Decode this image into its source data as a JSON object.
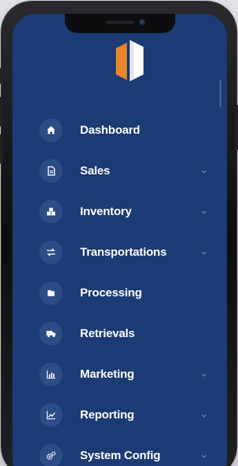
{
  "app": {
    "logo_icon": "hexagon-logo-icon",
    "brand_colors": {
      "orange": "#e8842c",
      "white": "#ffffff",
      "navy": "#1c3a73",
      "icon_bg": "#2d4c85"
    }
  },
  "menu": {
    "items": [
      {
        "label": "Dashboard",
        "icon": "home-icon",
        "has_submenu": false
      },
      {
        "label": "Sales",
        "icon": "document-icon",
        "has_submenu": true
      },
      {
        "label": "Inventory",
        "icon": "boxes-icon",
        "has_submenu": true
      },
      {
        "label": "Transportations",
        "icon": "transfer-arrows-icon",
        "has_submenu": true
      },
      {
        "label": "Processing",
        "icon": "folder-icon",
        "has_submenu": false
      },
      {
        "label": "Retrievals",
        "icon": "truck-icon",
        "has_submenu": false
      },
      {
        "label": "Marketing",
        "icon": "bar-chart-icon",
        "has_submenu": true
      },
      {
        "label": "Reporting",
        "icon": "line-chart-icon",
        "has_submenu": true
      },
      {
        "label": "System Config",
        "icon": "gears-icon",
        "has_submenu": true
      }
    ]
  }
}
